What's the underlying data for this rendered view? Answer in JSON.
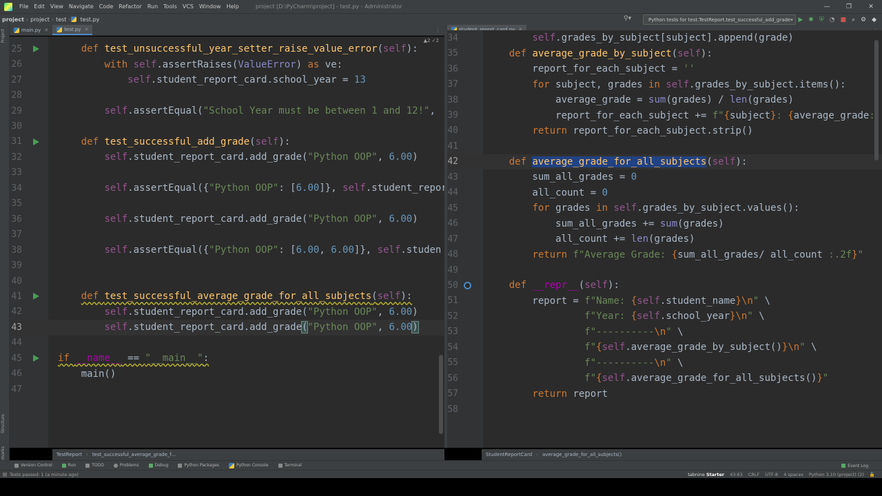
{
  "window": {
    "title": "project [D:\\PyCharm\\project] - test.py - Administrator",
    "menu": [
      "File",
      "Edit",
      "View",
      "Navigate",
      "Code",
      "Refactor",
      "Run",
      "Tools",
      "VCS",
      "Window",
      "Help"
    ],
    "controls": [
      "—",
      "❐",
      "✕"
    ]
  },
  "navbar": {
    "crumbs": [
      "project",
      "project",
      "test",
      "test.py"
    ],
    "run_config": "Python tests for test.TestReport.test_successful_add_grade"
  },
  "left_tabs": {
    "project": "Project",
    "structure": "Structure",
    "bookmarks": "Bookmarks"
  },
  "left_editor": {
    "tabs": [
      {
        "label": "main.py",
        "active": false
      },
      {
        "label": "test.py",
        "active": true
      }
    ],
    "inspection": "▲2 ✓2",
    "lines": [
      {
        "n": "25",
        "tokens": [
          {
            "t": "    "
          },
          {
            "t": "def ",
            "c": "kw"
          },
          {
            "t": "test_unsuccessful_year_setter_raise_value_error",
            "c": "fn"
          },
          {
            "t": "("
          },
          {
            "t": "self",
            "c": "self"
          },
          {
            "t": "):"
          }
        ]
      },
      {
        "n": "26",
        "tokens": [
          {
            "t": "        "
          },
          {
            "t": "with ",
            "c": "kw"
          },
          {
            "t": "self",
            "c": "self"
          },
          {
            "t": ".assertRaises("
          },
          {
            "t": "ValueError",
            "c": "blt"
          },
          {
            "t": ") "
          },
          {
            "t": "as ",
            "c": "kw"
          },
          {
            "t": "ve:"
          }
        ]
      },
      {
        "n": "27",
        "tokens": [
          {
            "t": "            "
          },
          {
            "t": "self",
            "c": "self"
          },
          {
            "t": ".student_report_card.school_year = "
          },
          {
            "t": "13",
            "c": "num"
          }
        ]
      },
      {
        "n": "28",
        "tokens": []
      },
      {
        "n": "29",
        "tokens": [
          {
            "t": "        "
          },
          {
            "t": "self",
            "c": "self"
          },
          {
            "t": ".assertEqual("
          },
          {
            "t": "\"School Year must be between 1 and 12!\"",
            "c": "str"
          },
          {
            "t": ", "
          }
        ]
      },
      {
        "n": "30",
        "tokens": []
      },
      {
        "n": "31",
        "tokens": [
          {
            "t": "    "
          },
          {
            "t": "def ",
            "c": "kw"
          },
          {
            "t": "test_successful_add_grade",
            "c": "fn"
          },
          {
            "t": "("
          },
          {
            "t": "self",
            "c": "self"
          },
          {
            "t": "):"
          }
        ]
      },
      {
        "n": "32",
        "tokens": [
          {
            "t": "        "
          },
          {
            "t": "self",
            "c": "self"
          },
          {
            "t": ".student_report_card.add_grade("
          },
          {
            "t": "\"Python OOP\"",
            "c": "str"
          },
          {
            "t": ", "
          },
          {
            "t": "6.00",
            "c": "num"
          },
          {
            "t": ")"
          }
        ]
      },
      {
        "n": "33",
        "tokens": []
      },
      {
        "n": "34",
        "tokens": [
          {
            "t": "        "
          },
          {
            "t": "self",
            "c": "self"
          },
          {
            "t": ".assertEqual({"
          },
          {
            "t": "\"Python OOP\"",
            "c": "str"
          },
          {
            "t": ": ["
          },
          {
            "t": "6.00",
            "c": "num"
          },
          {
            "t": "]}, "
          },
          {
            "t": "self",
            "c": "self"
          },
          {
            "t": ".student_repor"
          }
        ]
      },
      {
        "n": "35",
        "tokens": []
      },
      {
        "n": "36",
        "tokens": [
          {
            "t": "        "
          },
          {
            "t": "self",
            "c": "self"
          },
          {
            "t": ".student_report_card.add_grade("
          },
          {
            "t": "\"Python OOP\"",
            "c": "str"
          },
          {
            "t": ", "
          },
          {
            "t": "6.00",
            "c": "num"
          },
          {
            "t": ")"
          }
        ]
      },
      {
        "n": "37",
        "tokens": []
      },
      {
        "n": "38",
        "tokens": [
          {
            "t": "        "
          },
          {
            "t": "self",
            "c": "self"
          },
          {
            "t": ".assertEqual({"
          },
          {
            "t": "\"Python OOP\"",
            "c": "str"
          },
          {
            "t": ": ["
          },
          {
            "t": "6.00",
            "c": "num"
          },
          {
            "t": ", "
          },
          {
            "t": "6.00",
            "c": "num"
          },
          {
            "t": "]}, "
          },
          {
            "t": "self",
            "c": "self"
          },
          {
            "t": ".studen"
          }
        ]
      },
      {
        "n": "39",
        "tokens": []
      },
      {
        "n": "40",
        "tokens": []
      },
      {
        "n": "41",
        "tokens": [
          {
            "t": "    "
          },
          {
            "t": "def ",
            "c": "kw under"
          },
          {
            "t": "test_successful_average_grade_for_all_subjects",
            "c": "fn under"
          },
          {
            "t": "(",
            "c": "under"
          },
          {
            "t": "self",
            "c": "self under"
          },
          {
            "t": "):",
            "c": "under"
          }
        ]
      },
      {
        "n": "42",
        "tokens": [
          {
            "t": "        "
          },
          {
            "t": "self",
            "c": "self"
          },
          {
            "t": ".student_report_card.add_grade("
          },
          {
            "t": "\"Python OOP\"",
            "c": "str"
          },
          {
            "t": ", "
          },
          {
            "t": "6.00",
            "c": "num"
          },
          {
            "t": ")"
          }
        ]
      },
      {
        "n": "43",
        "tokens": [
          {
            "t": "        "
          },
          {
            "t": "self",
            "c": "self"
          },
          {
            "t": ".student_report_card.add_grade"
          },
          {
            "t": "(",
            "c": "brace"
          },
          {
            "t": "\"Python OOP\"",
            "c": "str"
          },
          {
            "t": ", "
          },
          {
            "t": "6.00",
            "c": "num"
          },
          {
            "t": ")",
            "c": "brace"
          }
        ]
      },
      {
        "n": "44",
        "tokens": []
      },
      {
        "n": "45",
        "tokens": [
          {
            "t": "if ",
            "c": "kw under"
          },
          {
            "t": "__name__",
            "c": "magic under"
          },
          {
            "t": " == ",
            "c": "under"
          },
          {
            "t": "\"__main__\"",
            "c": "str under"
          },
          {
            "t": ":",
            "c": "under"
          }
        ]
      },
      {
        "n": "46",
        "tokens": [
          {
            "t": "    main()"
          }
        ]
      },
      {
        "n": "47",
        "tokens": []
      }
    ],
    "breadcrumbs": [
      "TestReport",
      "test_successful_average_grade_f..."
    ]
  },
  "right_editor": {
    "tabs": [
      {
        "label": "student_report_card.py",
        "active": true
      }
    ],
    "lines": [
      {
        "n": "34",
        "tokens": [
          {
            "t": "        "
          },
          {
            "t": "self",
            "c": "self"
          },
          {
            "t": ".grades_by_subject[subject].append(grade)"
          }
        ]
      },
      {
        "n": "35",
        "tokens": [
          {
            "t": "    "
          },
          {
            "t": "def ",
            "c": "kw"
          },
          {
            "t": "average_grade_by_subject",
            "c": "fn"
          },
          {
            "t": "("
          },
          {
            "t": "self",
            "c": "self"
          },
          {
            "t": "):"
          }
        ]
      },
      {
        "n": "36",
        "tokens": [
          {
            "t": "        report_for_each_subject = "
          },
          {
            "t": "''",
            "c": "str"
          }
        ]
      },
      {
        "n": "37",
        "tokens": [
          {
            "t": "        "
          },
          {
            "t": "for ",
            "c": "kw"
          },
          {
            "t": "subject, grades "
          },
          {
            "t": "in ",
            "c": "kw"
          },
          {
            "t": "self",
            "c": "self"
          },
          {
            "t": ".grades_by_subject.items():"
          }
        ]
      },
      {
        "n": "38",
        "tokens": [
          {
            "t": "            average_grade = "
          },
          {
            "t": "sum",
            "c": "blt"
          },
          {
            "t": "(grades) / "
          },
          {
            "t": "len",
            "c": "blt"
          },
          {
            "t": "(grades)"
          }
        ]
      },
      {
        "n": "39",
        "tokens": [
          {
            "t": "            report_for_each_subject += "
          },
          {
            "t": "f\"",
            "c": "str"
          },
          {
            "t": "{",
            "c": "kw"
          },
          {
            "t": "subject"
          },
          {
            "t": "}",
            "c": "kw"
          },
          {
            "t": ": ",
            "c": "str"
          },
          {
            "t": "{",
            "c": "kw"
          },
          {
            "t": "average_grade"
          },
          {
            "t": ":.",
            "c": "str"
          }
        ]
      },
      {
        "n": "40",
        "tokens": [
          {
            "t": "        "
          },
          {
            "t": "return ",
            "c": "kw"
          },
          {
            "t": "report_for_each_subject.strip()"
          }
        ]
      },
      {
        "n": "41",
        "tokens": []
      },
      {
        "n": "42",
        "tokens": [
          {
            "t": "    "
          },
          {
            "t": "def ",
            "c": "kw"
          },
          {
            "t": "average_grade_for_all_subjects",
            "c": "fn sel"
          },
          {
            "t": "("
          },
          {
            "t": "self",
            "c": "self"
          },
          {
            "t": "):"
          }
        ]
      },
      {
        "n": "43",
        "tokens": [
          {
            "t": "        sum_all_grades = "
          },
          {
            "t": "0",
            "c": "num"
          }
        ]
      },
      {
        "n": "44",
        "tokens": [
          {
            "t": "        all_count = "
          },
          {
            "t": "0",
            "c": "num"
          }
        ]
      },
      {
        "n": "45",
        "tokens": [
          {
            "t": "        "
          },
          {
            "t": "for ",
            "c": "kw"
          },
          {
            "t": "grades "
          },
          {
            "t": "in ",
            "c": "kw"
          },
          {
            "t": "self",
            "c": "self"
          },
          {
            "t": ".grades_by_subject.values():"
          }
        ]
      },
      {
        "n": "46",
        "tokens": [
          {
            "t": "            sum_all_grades += "
          },
          {
            "t": "sum",
            "c": "blt"
          },
          {
            "t": "(grades)"
          }
        ]
      },
      {
        "n": "47",
        "tokens": [
          {
            "t": "            all_count += "
          },
          {
            "t": "len",
            "c": "blt"
          },
          {
            "t": "(grades)"
          }
        ]
      },
      {
        "n": "48",
        "tokens": [
          {
            "t": "        "
          },
          {
            "t": "return ",
            "c": "kw"
          },
          {
            "t": "f\"Average Grade: ",
            "c": "str"
          },
          {
            "t": "{",
            "c": "kw"
          },
          {
            "t": "sum_all_grades/ all_count "
          },
          {
            "t": ":.2f",
            "c": "str"
          },
          {
            "t": "}",
            "c": "kw"
          },
          {
            "t": "\"",
            "c": "str"
          }
        ]
      },
      {
        "n": "49",
        "tokens": []
      },
      {
        "n": "50",
        "tokens": [
          {
            "t": "    "
          },
          {
            "t": "def ",
            "c": "kw"
          },
          {
            "t": "__repr__",
            "c": "magic"
          },
          {
            "t": "("
          },
          {
            "t": "self",
            "c": "self"
          },
          {
            "t": "):"
          }
        ]
      },
      {
        "n": "51",
        "tokens": [
          {
            "t": "        report = "
          },
          {
            "t": "f\"Name: ",
            "c": "str"
          },
          {
            "t": "{",
            "c": "kw"
          },
          {
            "t": "self",
            "c": "self"
          },
          {
            "t": ".student_name"
          },
          {
            "t": "}",
            "c": "kw"
          },
          {
            "t": "\\n",
            "c": "kw"
          },
          {
            "t": "\"",
            "c": "str"
          },
          {
            "t": " \\"
          }
        ]
      },
      {
        "n": "52",
        "tokens": [
          {
            "t": "                 "
          },
          {
            "t": "f\"Year: ",
            "c": "str"
          },
          {
            "t": "{",
            "c": "kw"
          },
          {
            "t": "self",
            "c": "self"
          },
          {
            "t": ".school_year"
          },
          {
            "t": "}",
            "c": "kw"
          },
          {
            "t": "\\n",
            "c": "kw"
          },
          {
            "t": "\"",
            "c": "str"
          },
          {
            "t": " \\"
          }
        ]
      },
      {
        "n": "53",
        "tokens": [
          {
            "t": "                 "
          },
          {
            "t": "f\"----------",
            "c": "str"
          },
          {
            "t": "\\n",
            "c": "kw"
          },
          {
            "t": "\"",
            "c": "str"
          },
          {
            "t": " \\"
          }
        ]
      },
      {
        "n": "54",
        "tokens": [
          {
            "t": "                 "
          },
          {
            "t": "f\"",
            "c": "str"
          },
          {
            "t": "{",
            "c": "kw"
          },
          {
            "t": "self",
            "c": "self"
          },
          {
            "t": ".average_grade_by_subject()"
          },
          {
            "t": "}",
            "c": "kw"
          },
          {
            "t": "\\n",
            "c": "kw"
          },
          {
            "t": "\"",
            "c": "str"
          },
          {
            "t": " \\"
          }
        ]
      },
      {
        "n": "55",
        "tokens": [
          {
            "t": "                 "
          },
          {
            "t": "f\"----------",
            "c": "str"
          },
          {
            "t": "\\n",
            "c": "kw"
          },
          {
            "t": "\"",
            "c": "str"
          },
          {
            "t": " \\"
          }
        ]
      },
      {
        "n": "56",
        "tokens": [
          {
            "t": "                 "
          },
          {
            "t": "f\"",
            "c": "str"
          },
          {
            "t": "{",
            "c": "kw"
          },
          {
            "t": "self",
            "c": "self"
          },
          {
            "t": ".average_grade_for_all_subjects()"
          },
          {
            "t": "}",
            "c": "kw"
          },
          {
            "t": "\"",
            "c": "str"
          }
        ]
      },
      {
        "n": "57",
        "tokens": [
          {
            "t": "        "
          },
          {
            "t": "return ",
            "c": "kw"
          },
          {
            "t": "report"
          }
        ]
      },
      {
        "n": "58",
        "tokens": []
      }
    ],
    "breadcrumbs": [
      "StudentReportCard",
      "average_grade_for_all_subjects()"
    ]
  },
  "bottom_toolbar": {
    "items": [
      "Version Control",
      "Run",
      "TODO",
      "Problems",
      "Debug",
      "Python Packages",
      "Python Console",
      "Terminal"
    ],
    "event_log": "Event Log"
  },
  "status": {
    "message": "Tests passed: 1 (a minute ago)",
    "tabnine_prefix": "tabnine",
    "tabnine_plan": "Starter",
    "position": "43:63",
    "line_sep": "CRLF",
    "encoding": "UTF-8",
    "indent": "4 spaces",
    "interpreter": "Python 3.10 (project) (2)"
  },
  "colors": {
    "keyword": "#cc7832",
    "function": "#ffc66d",
    "self": "#94558d",
    "string": "#6a8759",
    "number": "#6897bb",
    "editor_bg": "#2b2b2b"
  }
}
